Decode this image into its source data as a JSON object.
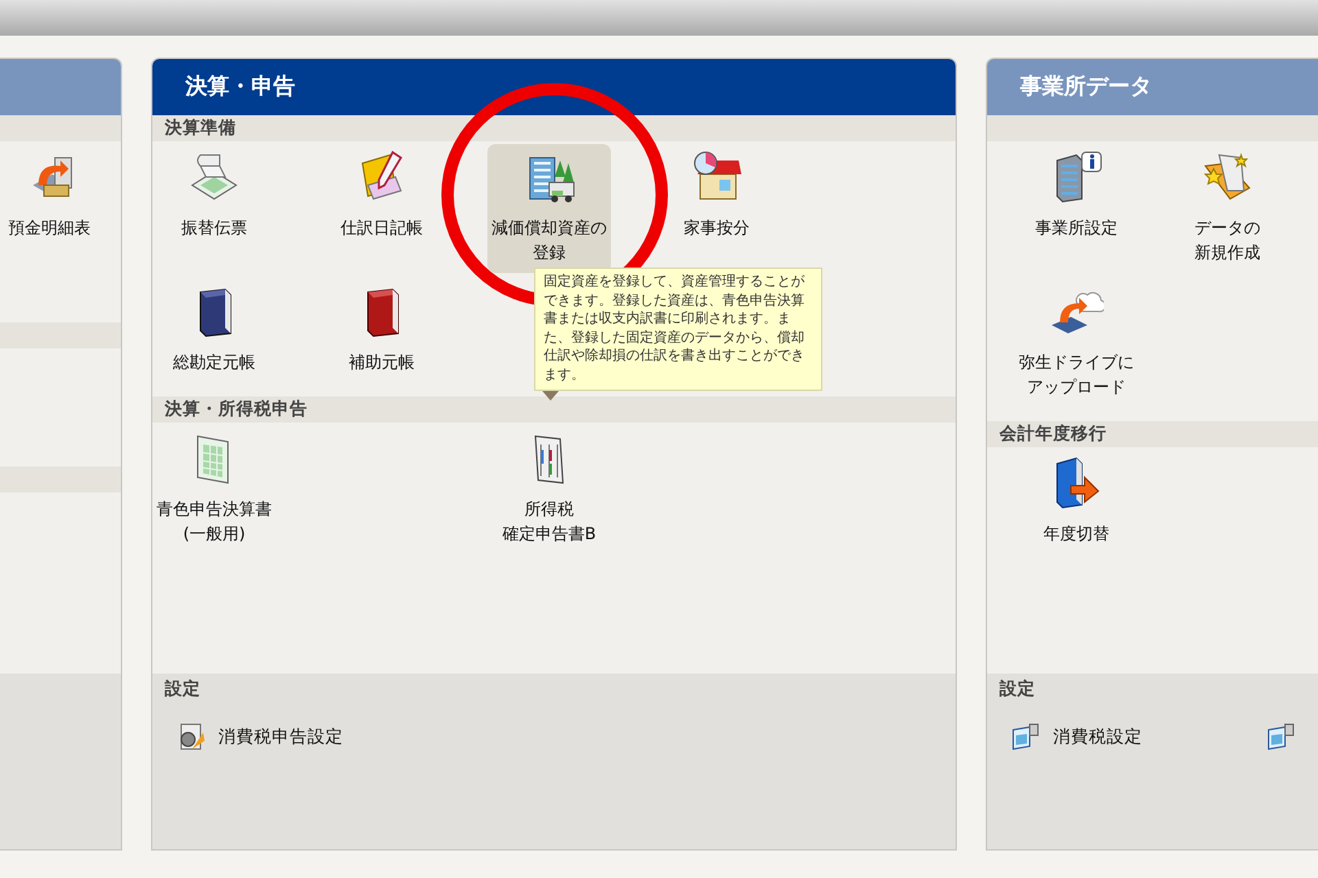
{
  "left_panel": {
    "active": false,
    "items": [
      {
        "lines": [
          "預金明細表"
        ],
        "highlighted": false
      }
    ]
  },
  "main_panel": {
    "title": "決算・申告",
    "active": true,
    "sections": [
      {
        "title": "決算準備",
        "items": [
          {
            "lines": [
              "振替伝票"
            ],
            "highlighted": false
          },
          {
            "lines": [
              "仕訳日記帳"
            ],
            "highlighted": false
          },
          {
            "lines": [
              "減価償却資産の",
              "登録"
            ],
            "highlighted": true
          },
          {
            "lines": [
              "家事按分"
            ],
            "highlighted": false
          },
          {
            "lines": [
              "総勘定元帳"
            ],
            "highlighted": false
          },
          {
            "lines": [
              "補助元帳"
            ],
            "highlighted": false
          }
        ]
      },
      {
        "title": "決算・所得税申告",
        "items": [
          {
            "lines": [
              "青色申告決算書",
              "(一般用)"
            ],
            "highlighted": false
          },
          {
            "lines": [
              "所得税",
              "確定申告書B"
            ],
            "highlighted": false
          }
        ]
      }
    ],
    "tooltip": {
      "text": "固定資産を登録して、資産管理することができます。登録した資産は、青色申告決算書または収支内訳書に印刷されます。また、登録した固定資産のデータから、償却仕訳や除却損の仕訳を書き出すことができます。"
    },
    "settings": {
      "title": "設定",
      "items": [
        {
          "label": "消費税申告設定"
        }
      ]
    }
  },
  "right_panel": {
    "title": "事業所データ",
    "active": false,
    "sections": [
      {
        "items": [
          {
            "lines": [
              "事業所設定"
            ],
            "highlighted": false
          },
          {
            "lines": [
              "データの",
              "新規作成"
            ],
            "highlighted": false
          },
          {
            "lines": [
              "弥生ドライブに",
              "アップロード"
            ],
            "highlighted": false
          }
        ]
      },
      {
        "title": "会計年度移行",
        "items": [
          {
            "lines": [
              "年度切替"
            ],
            "highlighted": false
          }
        ]
      }
    ],
    "settings": {
      "title": "設定",
      "items": [
        {
          "label": "消費税設定"
        }
      ]
    }
  }
}
